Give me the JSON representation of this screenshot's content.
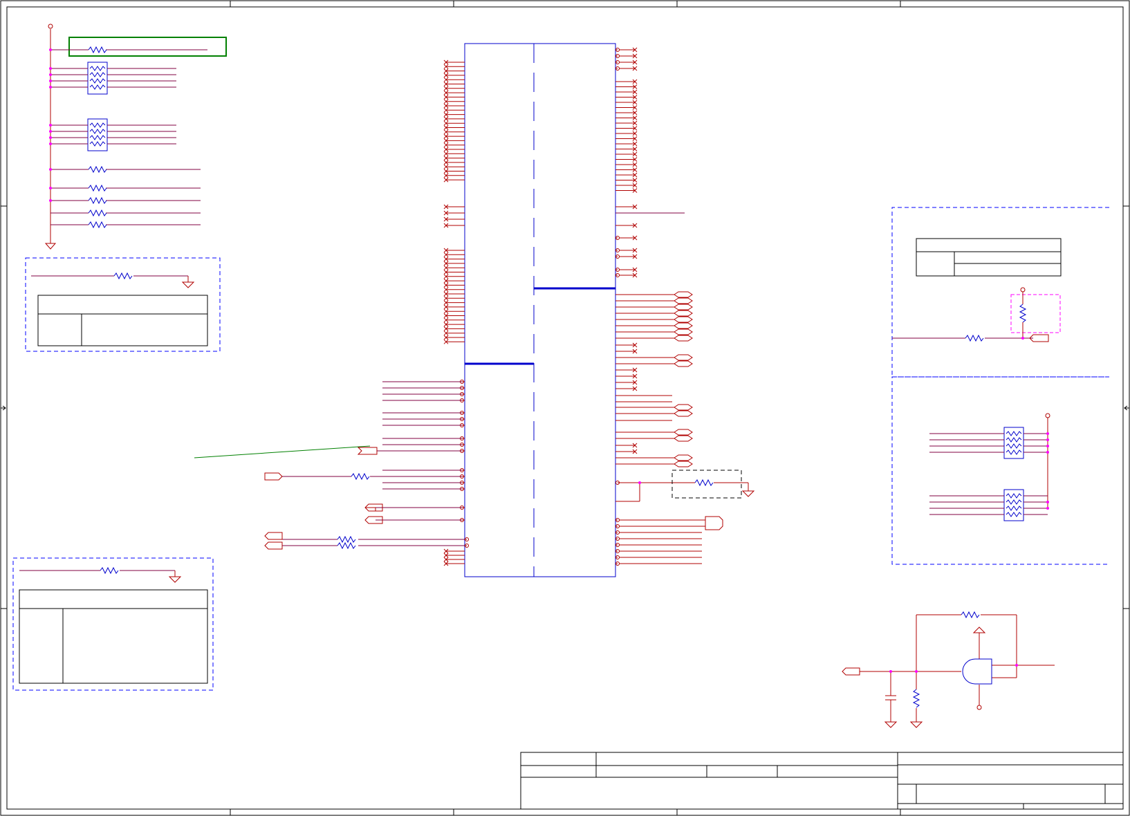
{
  "colors": {
    "frame": "#000000",
    "wire": "#b00000",
    "signal": "#800040",
    "component": "#0000cc",
    "junction": "#ff00ff",
    "highlight": "#008000",
    "note_box": "#0000ff",
    "pullup_box": "#ff00ff"
  },
  "diagram": {
    "type": "schematic",
    "border_column_markers": [
      "",
      "",
      "",
      ""
    ],
    "title_block": {
      "title": "",
      "document_number": "",
      "revision": "",
      "sheet": "",
      "date": ""
    }
  }
}
